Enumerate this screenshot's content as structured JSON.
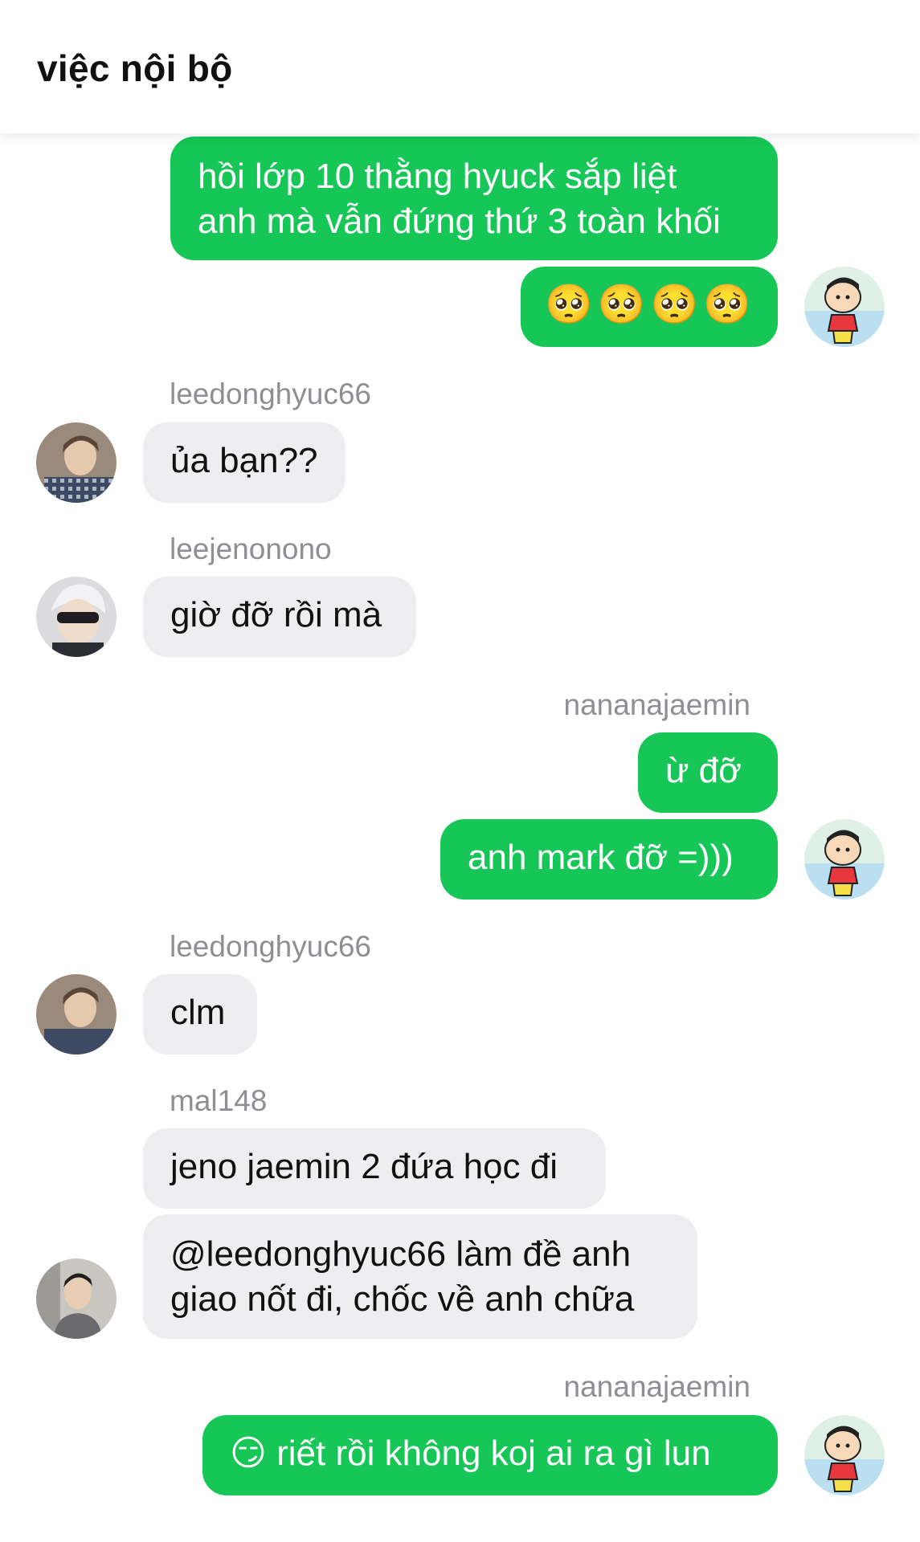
{
  "header": {
    "title": "việc nội bộ"
  },
  "messages": [
    {
      "text": "hồi lớp 10 thằng hyuck sắp liệt\nanh mà vẫn đứng thứ 3 toàn khối"
    },
    {
      "text": "🥺🥺🥺🥺"
    },
    {
      "sender": "leedonghyuc66",
      "text": "ủa bạn??"
    },
    {
      "sender": "leejenonono",
      "text": "giờ đỡ rồi mà"
    },
    {
      "sender": "nananajaemin",
      "text": "ừ đỡ"
    },
    {
      "text": "anh mark đỡ =)))"
    },
    {
      "sender": "leedonghyuc66",
      "text": "clm"
    },
    {
      "sender": "mal148",
      "text": "jeno jaemin 2 đứa học đi"
    },
    {
      "text": "@leedonghyuc66 làm đề anh\ngiao nốt đi, chốc về anh chữa"
    },
    {
      "sender": "nananajaemin",
      "text": "😏 riết rồi không koj ai ra gì lun"
    }
  ],
  "colors": {
    "sent_bubble": "#16c657",
    "received_bubble": "#eeeef0",
    "sender_name": "#8e8e93"
  },
  "avatars": [
    "shinchan-avatar",
    "user-photo-avatar"
  ]
}
